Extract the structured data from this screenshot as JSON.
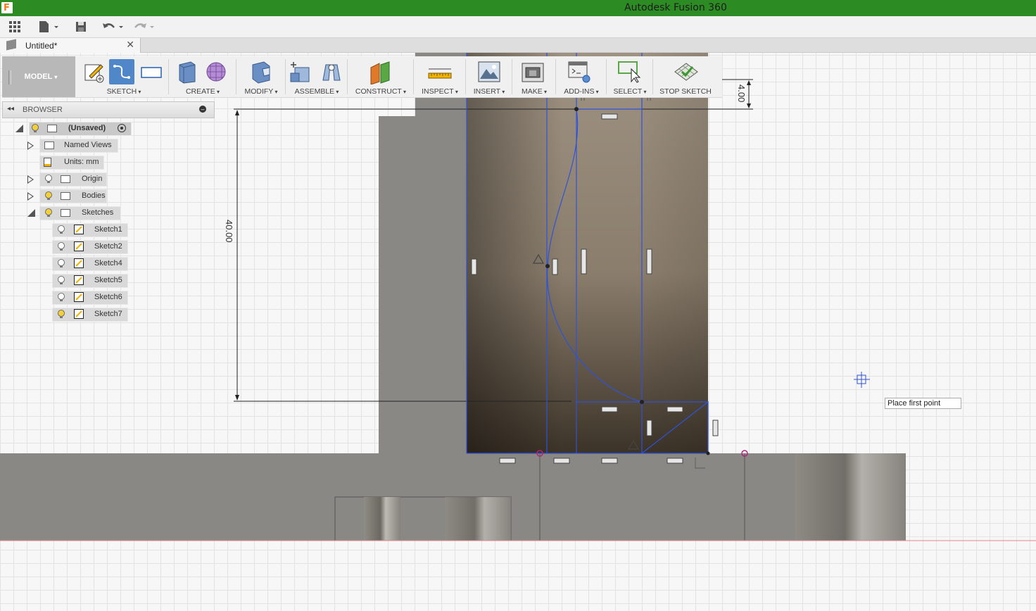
{
  "app": {
    "title": "Autodesk Fusion 360",
    "icon_letter": "F"
  },
  "quick_access": {
    "icons": [
      "grid-icon",
      "file-icon",
      "save-icon",
      "undo-icon",
      "redo-icon"
    ]
  },
  "document_tab": {
    "name": "Untitled*",
    "close": "✕"
  },
  "toolbar": {
    "workspace": "MODEL",
    "groups": [
      {
        "label": "SKETCH"
      },
      {
        "label": "CREATE"
      },
      {
        "label": "MODIFY"
      },
      {
        "label": "ASSEMBLE"
      },
      {
        "label": "CONSTRUCT"
      },
      {
        "label": "INSPECT"
      },
      {
        "label": "INSERT"
      },
      {
        "label": "MAKE"
      },
      {
        "label": "ADD-INS"
      },
      {
        "label": "SELECT"
      },
      {
        "label": "STOP SKETCH"
      }
    ]
  },
  "browser": {
    "title": "BROWSER",
    "root": "(Unsaved)",
    "items": [
      {
        "label": "Named Views"
      },
      {
        "label": "Units: mm"
      },
      {
        "label": "Origin"
      },
      {
        "label": "Bodies"
      },
      {
        "label": "Sketches"
      }
    ],
    "sketches": [
      "Sketch1",
      "Sketch2",
      "Sketch4",
      "Sketch5",
      "Sketch6",
      "Sketch7"
    ]
  },
  "canvas": {
    "dimension_vertical": "40.00",
    "dimension_small": "4.00",
    "tooltip": "Place first point"
  },
  "colors": {
    "title_bar": "#2d8b24",
    "sketch_line": "#3052d8",
    "active_tool": "#4f87c8"
  }
}
